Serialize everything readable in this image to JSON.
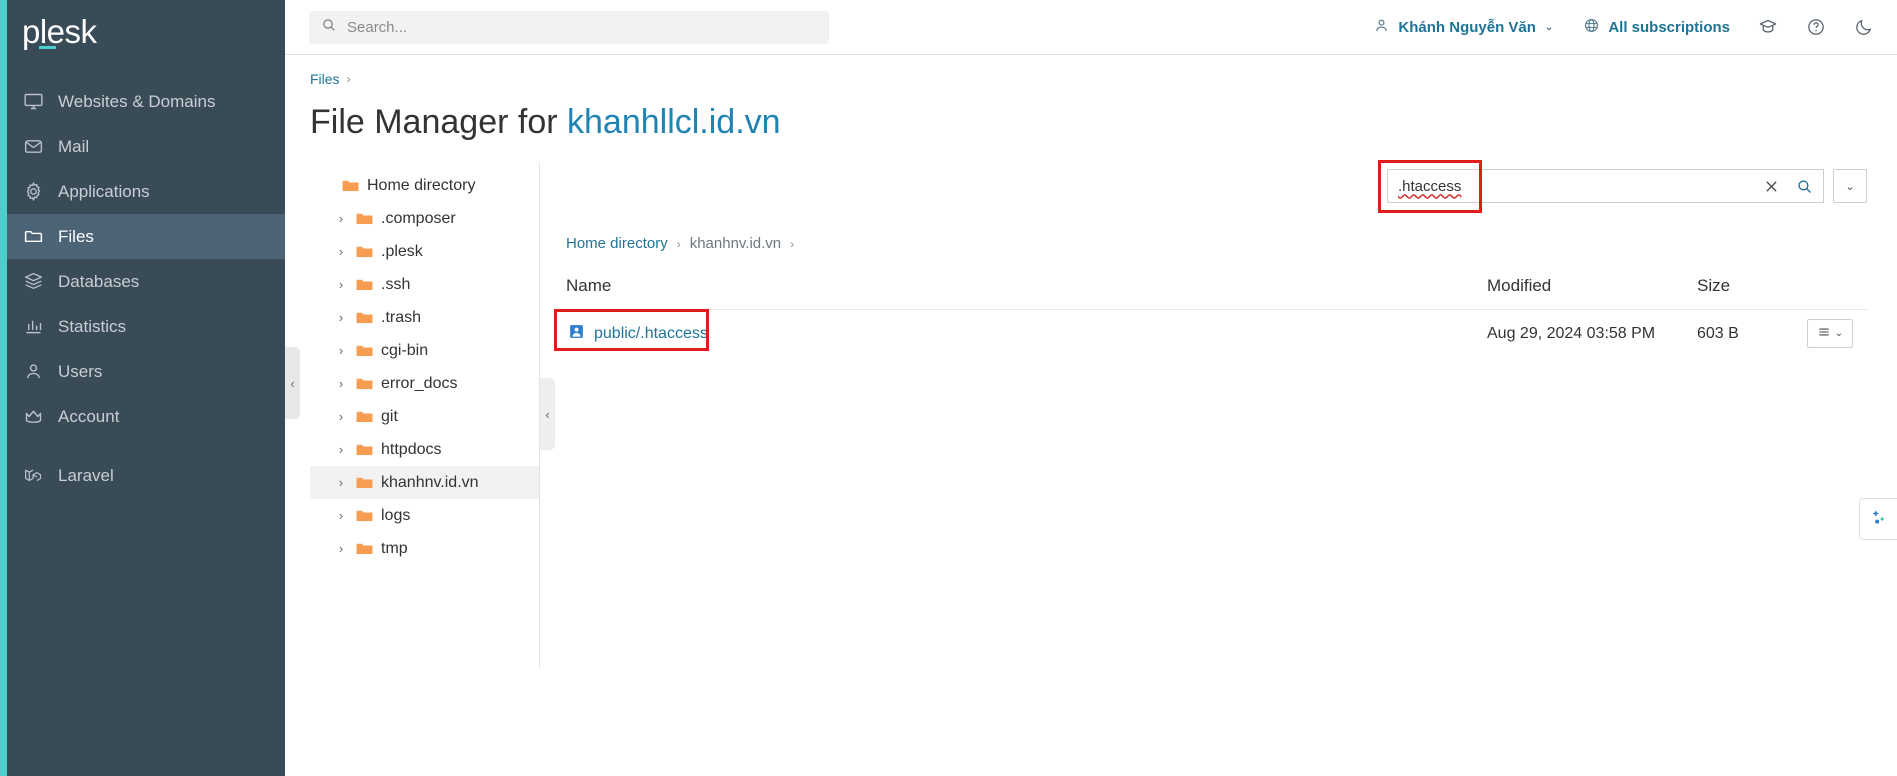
{
  "brand": {
    "logo": "plesk",
    "accent": "#4ccfca"
  },
  "sidebar": {
    "items": [
      {
        "label": "Websites & Domains",
        "icon": "monitor-icon",
        "active": false
      },
      {
        "label": "Mail",
        "icon": "envelope-icon",
        "active": false
      },
      {
        "label": "Applications",
        "icon": "gear-icon",
        "active": false
      },
      {
        "label": "Files",
        "icon": "folder-icon",
        "active": true
      },
      {
        "label": "Databases",
        "icon": "database-icon",
        "active": false
      },
      {
        "label": "Statistics",
        "icon": "bar-chart-icon",
        "active": false
      },
      {
        "label": "Users",
        "icon": "user-icon",
        "active": false
      },
      {
        "label": "Account",
        "icon": "crown-icon",
        "active": false
      },
      {
        "label": "Laravel",
        "icon": "laravel-icon",
        "active": false
      }
    ]
  },
  "topbar": {
    "search_placeholder": "Search...",
    "user_name": "Khánh Nguyễn Văn",
    "subscriptions_label": "All subscriptions",
    "icons": {
      "user": "user-icon",
      "globe": "globe-icon",
      "graduation": "graduation-cap-icon",
      "help": "question-mark-icon",
      "theme": "moon-icon"
    }
  },
  "breadcrumb_top": {
    "label": "Files",
    "separator": "›"
  },
  "page": {
    "title_prefix": "File Manager for ",
    "domain": "khanhllcl.id.vn"
  },
  "tree": {
    "root": {
      "label": "Home directory",
      "icon": "folder-icon"
    },
    "items": [
      {
        "label": ".composer",
        "selected": false
      },
      {
        "label": ".plesk",
        "selected": false
      },
      {
        "label": ".ssh",
        "selected": false
      },
      {
        "label": ".trash",
        "selected": false
      },
      {
        "label": "cgi-bin",
        "selected": false
      },
      {
        "label": "error_docs",
        "selected": false
      },
      {
        "label": "git",
        "selected": false
      },
      {
        "label": "httpdocs",
        "selected": false
      },
      {
        "label": "khanhnv.id.vn",
        "selected": true
      },
      {
        "label": "logs",
        "selected": false
      },
      {
        "label": "tmp",
        "selected": false
      }
    ],
    "collapse_handle": "‹"
  },
  "file_search": {
    "value": ".htaccess",
    "clear_icon": "close-icon",
    "search_icon": "search-icon",
    "dropdown_caret": "⌄",
    "highlight_color": "#e21b1b"
  },
  "path_breadcrumb": {
    "items": [
      {
        "label": "Home directory",
        "link": true
      },
      {
        "label": "khanhnv.id.vn",
        "link": false
      }
    ],
    "separator": "›"
  },
  "file_table": {
    "columns": {
      "name": "Name",
      "modified": "Modified",
      "size": "Size"
    },
    "rows": [
      {
        "name": "public/.htaccess",
        "icon": "htaccess-file-icon",
        "modified": "Aug 29, 2024 03:58 PM",
        "size": "603 B",
        "highlighted": true,
        "actions_icon": "list-menu-icon"
      }
    ]
  },
  "floating_widget": {
    "icon": "assistant-icon"
  }
}
